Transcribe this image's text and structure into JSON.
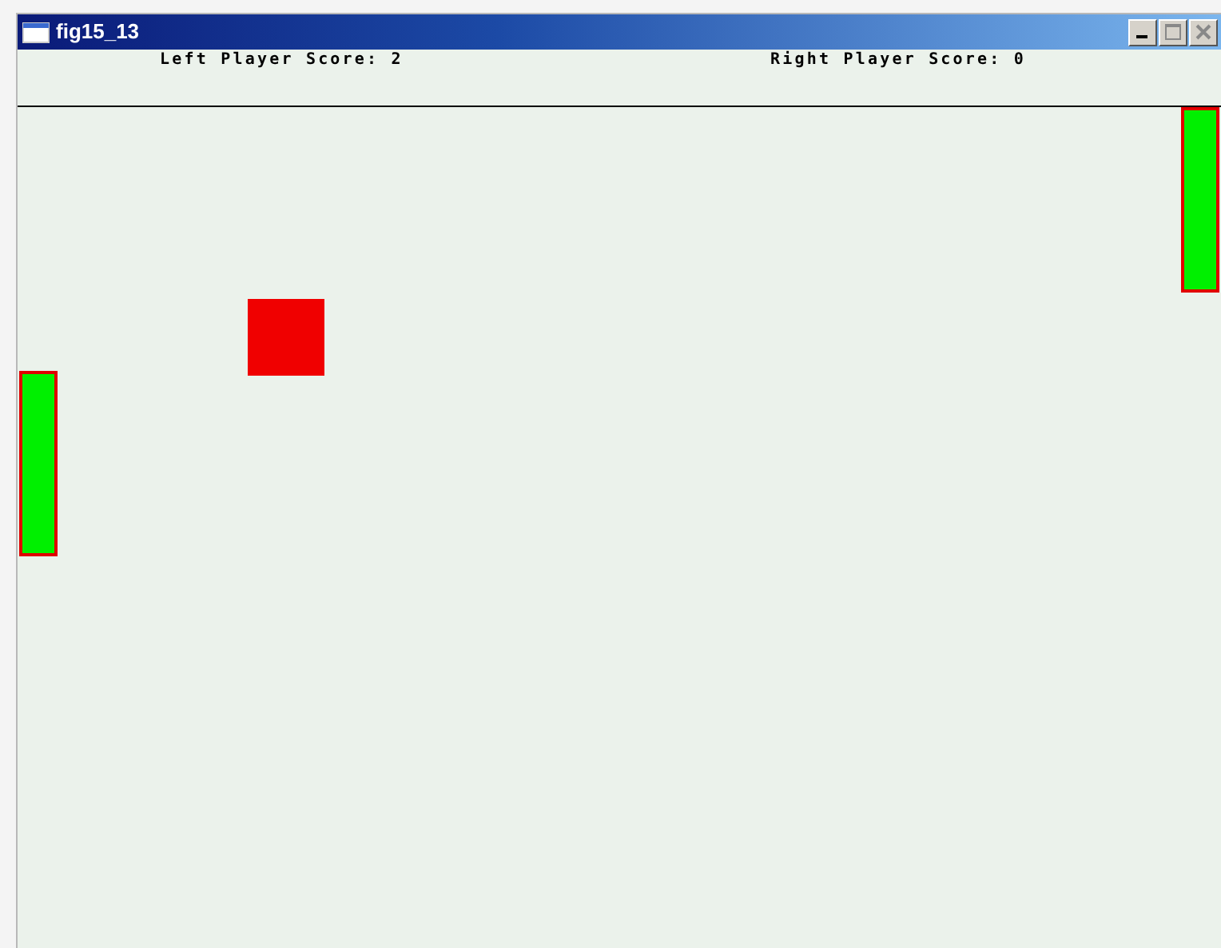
{
  "window": {
    "title": "fig15_13"
  },
  "scores": [
    {
      "text": "Left Player Score: 2"
    },
    {
      "text": "Right Player Score: 0"
    }
  ]
}
